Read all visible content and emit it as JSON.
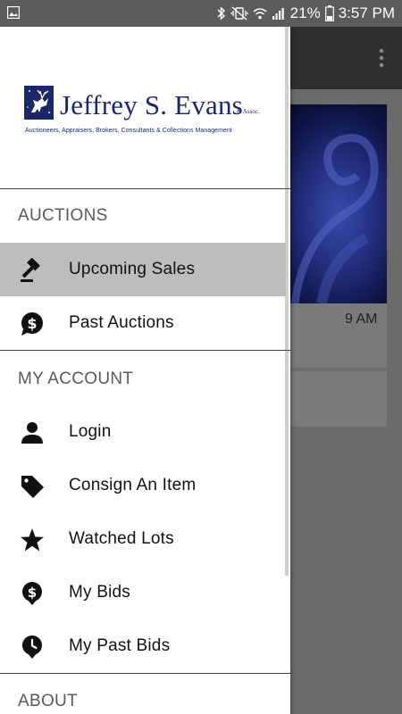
{
  "status_bar": {
    "battery_percent": "21%",
    "time": "3:57 PM"
  },
  "background_app": {
    "card_time": "9 AM"
  },
  "drawer": {
    "logo": {
      "name": "Jeffrey S. Evans",
      "assoc": "& Assoc.",
      "tagline": "Auctioneers, Appraisers, Brokers, Consultants & Collections Management"
    },
    "sections": {
      "auctions": "AUCTIONS",
      "my_account": "MY ACCOUNT",
      "about": "ABOUT"
    },
    "items": {
      "upcoming_sales": "Upcoming Sales",
      "past_auctions": "Past Auctions",
      "login": "Login",
      "consign": "Consign An Item",
      "watched_lots": "Watched Lots",
      "my_bids": "My Bids",
      "my_past_bids": "My Past Bids"
    },
    "active_item": "upcoming_sales",
    "colors": {
      "logo_blue": "#1a2868",
      "active_bg": "#bdbdbd"
    }
  }
}
